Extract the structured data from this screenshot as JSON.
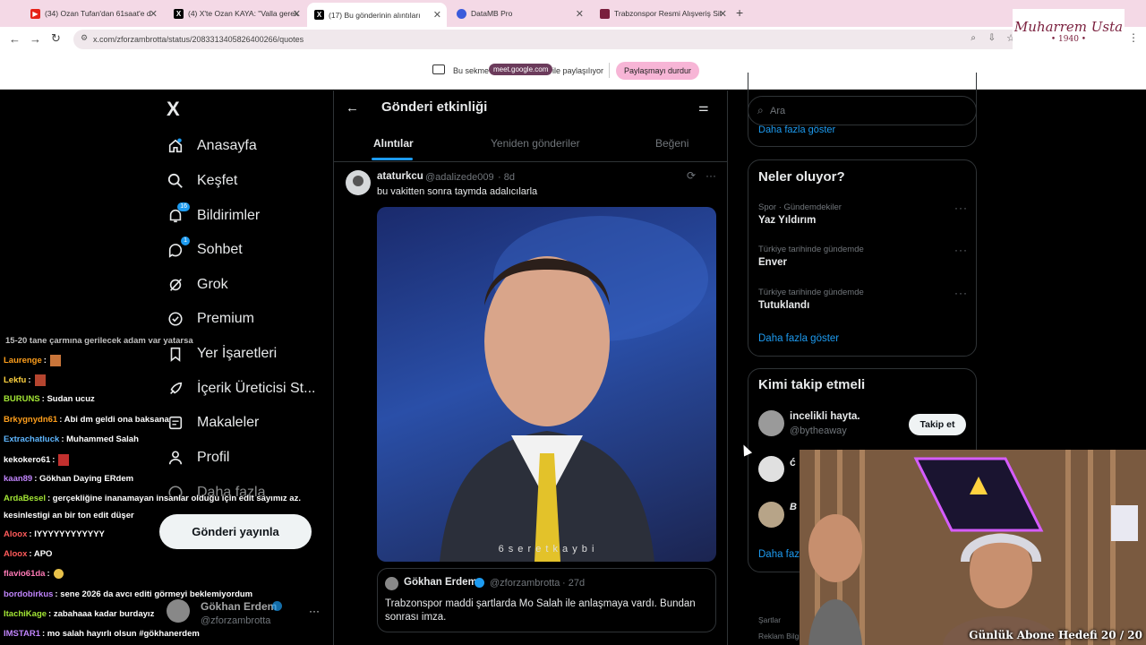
{
  "browser": {
    "tabs": [
      {
        "title": "(34) Ozan Tufan'dan 61saat'e d",
        "icon": "youtube-icon",
        "color": "#e62117"
      },
      {
        "title": "(4) X'te Ozan KAYA: \"Valla gerek",
        "icon": "x-icon",
        "color": "#000000"
      },
      {
        "title": "(17) Bu gönderinin alıntıları",
        "icon": "x-icon",
        "color": "#000000"
      },
      {
        "title": "DataMB Pro",
        "icon": "datamb-icon",
        "color": "#3b5bdb"
      },
      {
        "title": "Trabzonspor Resmi Alışveriş Sit",
        "icon": "trabzonspor-icon",
        "color": "#7a1f3d"
      }
    ],
    "new_tab": "+",
    "url": "x.com/zforzambrotta/status/2083313405826400266/quotes"
  },
  "share_bar": {
    "prefix": "Bu sekme",
    "domain": "meet.google.com",
    "suffix": "ile paylaşılıyor",
    "stop_button": "Paylaşmayı durdur"
  },
  "sidebar": {
    "logo": "X",
    "items": [
      {
        "label": "Anasayfa",
        "icon": "home-icon"
      },
      {
        "label": "Keşfet",
        "icon": "search-icon"
      },
      {
        "label": "Bildirimler",
        "icon": "bell-icon",
        "badge": "16"
      },
      {
        "label": "Sohbet",
        "icon": "chat-icon",
        "badge": "1"
      },
      {
        "label": "Grok",
        "icon": "grok-icon"
      },
      {
        "label": "Premium",
        "icon": "premium-icon"
      },
      {
        "label": "Yer İşaretleri",
        "icon": "bookmark-icon"
      },
      {
        "label": "İçerik Üreticisi St...",
        "icon": "rocket-icon"
      },
      {
        "label": "Makaleler",
        "icon": "article-icon"
      },
      {
        "label": "Profil",
        "icon": "profile-icon"
      },
      {
        "label": "Daha fazla",
        "icon": "more-icon"
      }
    ],
    "post_button": "Gönderi yayınla",
    "account": {
      "name": "Gökhan Erdem",
      "handle": "@zforzambrotta"
    }
  },
  "main": {
    "header": "Gönderi etkinliği",
    "tabs": [
      "Alıntılar",
      "Yeniden gönderiler",
      "Beğeni"
    ],
    "post": {
      "name": "ataturkcu",
      "handle": "@adalizede009",
      "time": "· 8d",
      "text": "bu vakitten sonra taymda adalıcılarla",
      "video_caption": "6 s e r e t k a y b i",
      "quoted": {
        "name": "Gökhan Erdem",
        "handle": "@zforzambrotta",
        "time": "· 27d",
        "text_line1": "Trabzonspor maddi şartlarda Mo Salah ile anlaşmaya vardı. Bundan",
        "text_line2": "sonrası imza."
      }
    }
  },
  "right": {
    "search_placeholder": "Ara",
    "show_more_top": "Daha fazla göster",
    "trends_title": "Neler oluyor?",
    "trends": [
      {
        "meta": "Spor · Gündemdekiler",
        "title": "Yaz Yıldırım"
      },
      {
        "meta": "Türkiye tarihinde gündemde",
        "title": "Enver"
      },
      {
        "meta": "Türkiye tarihinde gündemde",
        "title": "Tutuklandı"
      }
    ],
    "show_more": "Daha fazla göster",
    "follow_title": "Kimi takip etmeli",
    "follow_first": {
      "name": "incelikli hayta.",
      "handle": "@bytheaway",
      "button": "Takip et"
    },
    "follow_partial": [
      "ć",
      "B"
    ],
    "show_more_follow": "Daha faz",
    "footer": [
      "Şartlar",
      "Reklam Bilgi"
    ]
  },
  "stream": {
    "logo_line1": "Muharrem Usta",
    "logo_line2": "• 1940 •",
    "goal": "Günlük Abone Hedefi 20 / 20",
    "chat": [
      {
        "user": "",
        "msg": "15-20 tane çarmına gerilecek adam var yatarsa",
        "color": "#cc66ff"
      },
      {
        "user": "Laurenge",
        "msg": ":",
        "color": "#ff9f1c"
      },
      {
        "user": "Lekfu",
        "msg": ":",
        "color": "#ffd23f"
      },
      {
        "user": "BURUNS",
        "msg": ": Sudan ucuz",
        "color": "#a3e635"
      },
      {
        "user": "Brkygnydn61",
        "msg": ": Abi dm geldi ona baksana",
        "color": "#ff9f1c"
      },
      {
        "user": "Extrachatluck",
        "msg": ": Muhammed Salah",
        "color": "#5eb6ff"
      },
      {
        "user": "kekokero61",
        "msg": ":",
        "color": "#ffffff"
      },
      {
        "user": "kaan89",
        "msg": ": Gökhan Daying ERdem",
        "color": "#c084fc"
      },
      {
        "user": "ArdaBesel",
        "msg": ": gerçekliğine inanamayan insanlar olduğu için edit sayımız az.",
        "color": "#a3e635"
      },
      {
        "user": "",
        "msg": "kesinlestigi an bir ton edit düşer",
        "color": "#ffffff"
      },
      {
        "user": "Aloox",
        "msg": ": IYYYYYYYYYYYY",
        "color": "#ff5a5a"
      },
      {
        "user": "Aloox",
        "msg": ": APO",
        "color": "#ff5a5a"
      },
      {
        "user": "flavio61da",
        "msg": ":",
        "color": "#ff7ab6"
      },
      {
        "user": "bordobirkus",
        "msg": ": sene 2026 da avcı editi görmeyi beklemiyordum",
        "color": "#c084fc"
      },
      {
        "user": "ItachiKage",
        "msg": ": zabahaaa kadar burdayız",
        "color": "#a3e635"
      },
      {
        "user": "IMSTAR1",
        "msg": ": mo salah hayırlı olsun #gökhanerdem",
        "color": "#c084fc"
      }
    ]
  }
}
